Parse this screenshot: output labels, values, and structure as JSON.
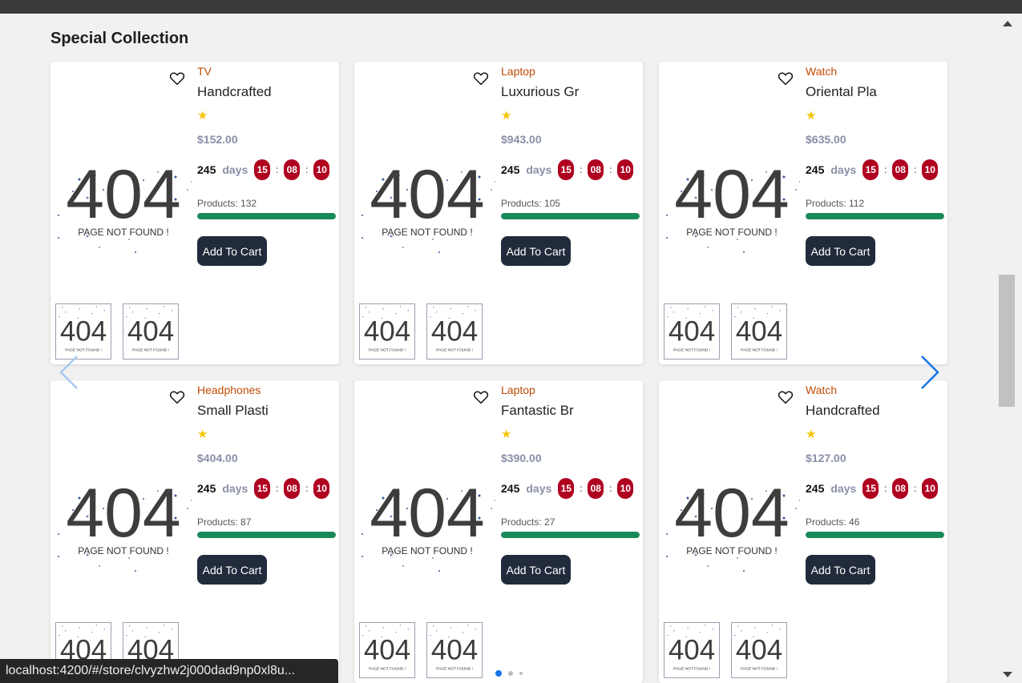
{
  "section": {
    "title": "Special Collection"
  },
  "placeholder": {
    "big": "404",
    "caption": "PAGE NOT FOUND !"
  },
  "colors": {
    "accent": "#1a73e8",
    "category": "#c24b07",
    "badge": "#b00020",
    "bar": "#1b8a5a",
    "button": "#212b3b"
  },
  "cards": [
    {
      "category": "TV",
      "name": "Handcrafted",
      "price": "$152.00",
      "countdown": {
        "days_num": "245",
        "days_label": "days",
        "h": "15",
        "m": "08",
        "s": "10"
      },
      "products": "Products: 132",
      "cart_label": "Add To Cart"
    },
    {
      "category": "Laptop",
      "name": "Luxurious Gr",
      "price": "$943.00",
      "countdown": {
        "days_num": "245",
        "days_label": "days",
        "h": "15",
        "m": "08",
        "s": "10"
      },
      "products": "Products: 105",
      "cart_label": "Add To Cart"
    },
    {
      "category": "Watch",
      "name": "Oriental Pla",
      "price": "$635.00",
      "countdown": {
        "days_num": "245",
        "days_label": "days",
        "h": "15",
        "m": "08",
        "s": "10"
      },
      "products": "Products: 112",
      "cart_label": "Add To Cart"
    },
    {
      "category": "Headphones",
      "name": "Small Plasti",
      "price": "$404.00",
      "countdown": {
        "days_num": "245",
        "days_label": "days",
        "h": "15",
        "m": "08",
        "s": "10"
      },
      "products": "Products: 87",
      "cart_label": "Add To Cart"
    },
    {
      "category": "Laptop",
      "name": "Fantastic Br",
      "price": "$390.00",
      "countdown": {
        "days_num": "245",
        "days_label": "days",
        "h": "15",
        "m": "08",
        "s": "10"
      },
      "products": "Products: 27",
      "cart_label": "Add To Cart"
    },
    {
      "category": "Watch",
      "name": "Handcrafted",
      "price": "$127.00",
      "countdown": {
        "days_num": "245",
        "days_label": "days",
        "h": "15",
        "m": "08",
        "s": "10"
      },
      "products": "Products: 46",
      "cart_label": "Add To Cart"
    }
  ],
  "carousel": {
    "prev_icon": "chevron-left-icon",
    "next_icon": "chevron-right-icon",
    "dots": 3,
    "active_dot": 0
  },
  "status_bar": {
    "url": "localhost:4200/#/store/clvyzhw2j000dad9np0xl8u..."
  }
}
